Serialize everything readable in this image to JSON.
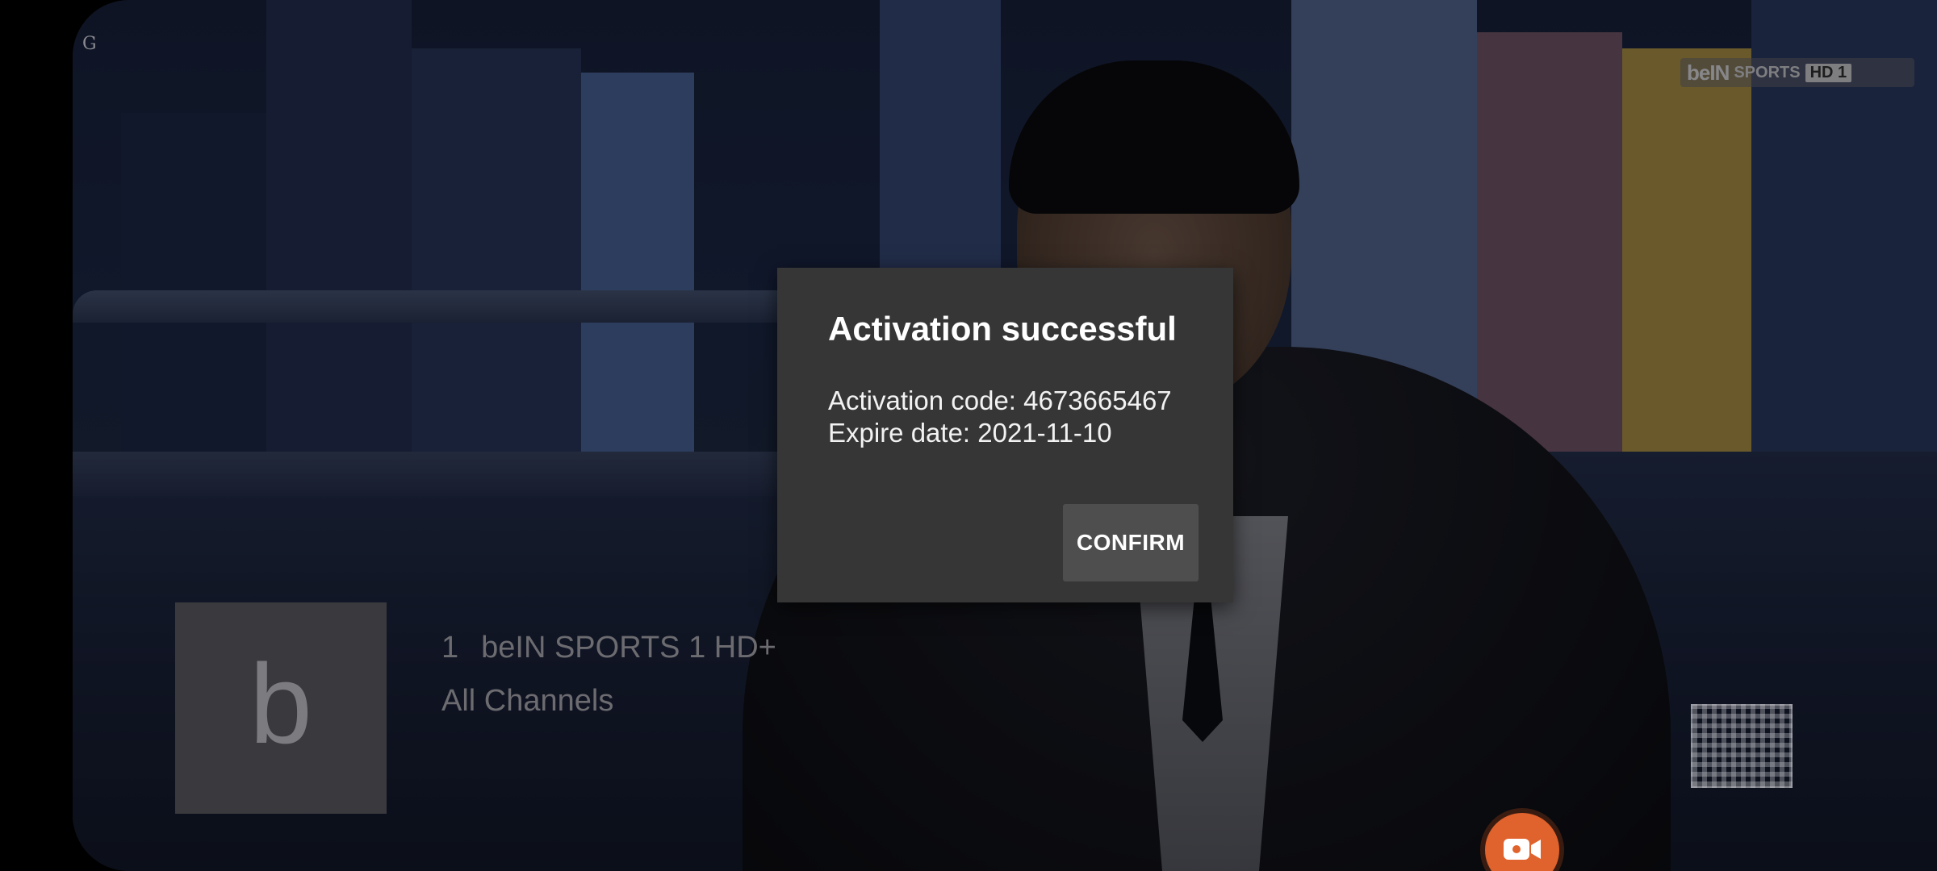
{
  "overlay_corner_mark": "G",
  "channel_logo": {
    "brand": "beIN",
    "sports": "SPORTS",
    "hd": "HD 1"
  },
  "channel_info": {
    "thumbnail_letter": "b",
    "number": "1",
    "name": "beIN SPORTS 1 HD+",
    "group": "All Channels"
  },
  "dialog": {
    "title": "Activation successful",
    "activation_code_line": "Activation code: 4673665467",
    "expire_date_line": "Expire date: 2021-11-10",
    "confirm_label": "CONFIRM"
  },
  "icons": {
    "record": "video-camera-icon",
    "qr": "qr-code-icon"
  },
  "colors": {
    "dialog_bg": "#363636",
    "confirm_bg": "#4e4e4e",
    "record_accent": "#e0622c"
  }
}
